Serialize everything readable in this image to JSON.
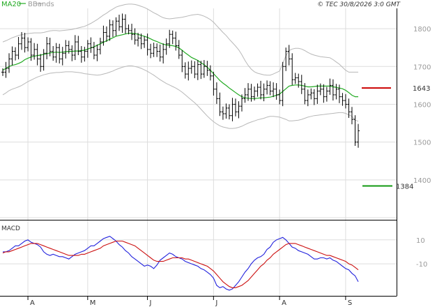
{
  "header": {
    "legend_ma": "MA20",
    "legend_bb": "BBands",
    "copyright": "© TEC 30/8/2026 3:0 GMT"
  },
  "macd_panel": {
    "title": "MACD"
  },
  "colors": {
    "ma": "#22aa22",
    "bbands": "#b8b8b8",
    "price": "#000000",
    "macd": "#2222dd",
    "signal": "#cc1111",
    "resistance": "#cc0000",
    "support": "#119911",
    "grid": "#dddddd"
  },
  "chart_data": [
    {
      "type": "ohlc",
      "x_tick_labels": [
        "A",
        "M",
        "J",
        "J",
        "A",
        "S"
      ],
      "y_ticks": [
        1400,
        1500,
        1600,
        1700,
        1800
      ],
      "ylim": [
        1300,
        1850
      ],
      "grid": true,
      "levels": [
        {
          "name": "resistance",
          "value": 1643,
          "label": "1643"
        },
        {
          "name": "support",
          "value": 1384,
          "label": "1384"
        }
      ],
      "close_series": [
        1685,
        1695,
        1720,
        1740,
        1730,
        1760,
        1775,
        1750,
        1765,
        1730,
        1745,
        1720,
        1700,
        1735,
        1760,
        1740,
        1725,
        1750,
        1720,
        1735,
        1755,
        1745,
        1730,
        1765,
        1740,
        1725,
        1740,
        1760,
        1750,
        1730,
        1745,
        1765,
        1790,
        1780,
        1810,
        1795,
        1820,
        1805,
        1825,
        1800,
        1795,
        1785,
        1770,
        1775,
        1760,
        1770,
        1745,
        1735,
        1750,
        1740,
        1725,
        1745,
        1760,
        1785,
        1775,
        1755,
        1730,
        1700,
        1680,
        1695,
        1700,
        1680,
        1705,
        1680,
        1700,
        1690,
        1675,
        1640,
        1615,
        1580,
        1575,
        1590,
        1570,
        1600,
        1580,
        1595,
        1615,
        1625,
        1640,
        1620,
        1635,
        1645,
        1625,
        1640,
        1650,
        1635,
        1640,
        1625,
        1610,
        1700,
        1740,
        1720,
        1665,
        1670,
        1660,
        1640,
        1610,
        1625,
        1630,
        1615,
        1635,
        1640,
        1620,
        1635,
        1650,
        1625,
        1640,
        1620,
        1610,
        1600,
        1580,
        1560,
        1500,
        1530
      ],
      "ma20": [
        1690,
        1695,
        1700,
        1703,
        1705,
        1708,
        1712,
        1718,
        1722,
        1725,
        1727,
        1729,
        1730,
        1732,
        1734,
        1736,
        1737,
        1738,
        1737,
        1738,
        1739,
        1740,
        1740,
        1741,
        1741,
        1742,
        1743,
        1746,
        1749,
        1752,
        1756,
        1760,
        1764,
        1768,
        1772,
        1776,
        1780,
        1782,
        1784,
        1786,
        1788,
        1788,
        1787,
        1785,
        1782,
        1780,
        1777,
        1773,
        1769,
        1766,
        1762,
        1759,
        1757,
        1756,
        1755,
        1753,
        1749,
        1743,
        1736,
        1730,
        1724,
        1720,
        1716,
        1710,
        1705,
        1698,
        1690,
        1681,
        1672,
        1663,
        1656,
        1650,
        1643,
        1637,
        1631,
        1625,
        1620,
        1617,
        1616,
        1615,
        1615,
        1616,
        1617,
        1617,
        1618,
        1619,
        1621,
        1624,
        1627,
        1634,
        1641,
        1648,
        1650,
        1651,
        1651,
        1650,
        1648,
        1646,
        1646,
        1647,
        1648,
        1648,
        1648,
        1648,
        1648,
        1646,
        1645,
        1643,
        1641,
        1637,
        1631,
        1624,
        1620,
        1620
      ],
      "bb_upper": [
        1765,
        1768,
        1772,
        1776,
        1779,
        1782,
        1784,
        1786,
        1787,
        1788,
        1789,
        1789,
        1789,
        1790,
        1792,
        1794,
        1795,
        1795,
        1794,
        1795,
        1796,
        1797,
        1798,
        1800,
        1802,
        1804,
        1806,
        1810,
        1814,
        1819,
        1824,
        1830,
        1836,
        1841,
        1847,
        1852,
        1857,
        1860,
        1862,
        1864,
        1865,
        1865,
        1864,
        1862,
        1859,
        1856,
        1852,
        1847,
        1842,
        1838,
        1833,
        1829,
        1827,
        1826,
        1827,
        1828,
        1829,
        1830,
        1832,
        1834,
        1836,
        1837,
        1838,
        1836,
        1833,
        1829,
        1824,
        1817,
        1808,
        1799,
        1790,
        1782,
        1772,
        1763,
        1754,
        1744,
        1731,
        1716,
        1703,
        1693,
        1686,
        1682,
        1680,
        1678,
        1677,
        1677,
        1680,
        1684,
        1688,
        1708,
        1728,
        1742,
        1746,
        1748,
        1748,
        1746,
        1742,
        1737,
        1733,
        1730,
        1728,
        1726,
        1725,
        1724,
        1723,
        1718,
        1712,
        1706,
        1698,
        1690,
        1685,
        1685,
        1685,
        1685
      ],
      "bb_lower": [
        1625,
        1630,
        1636,
        1640,
        1643,
        1646,
        1650,
        1655,
        1660,
        1664,
        1668,
        1672,
        1675,
        1678,
        1680,
        1682,
        1683,
        1684,
        1684,
        1685,
        1686,
        1686,
        1686,
        1685,
        1684,
        1683,
        1681,
        1680,
        1679,
        1678,
        1677,
        1678,
        1680,
        1682,
        1685,
        1688,
        1692,
        1695,
        1698,
        1700,
        1702,
        1702,
        1700,
        1698,
        1695,
        1691,
        1687,
        1682,
        1677,
        1671,
        1665,
        1660,
        1655,
        1651,
        1647,
        1643,
        1638,
        1632,
        1625,
        1618,
        1611,
        1604,
        1596,
        1587,
        1578,
        1569,
        1561,
        1554,
        1548,
        1543,
        1540,
        1538,
        1536,
        1536,
        1537,
        1539,
        1542,
        1546,
        1550,
        1553,
        1556,
        1559,
        1561,
        1563,
        1566,
        1568,
        1568,
        1567,
        1566,
        1563,
        1560,
        1556,
        1556,
        1557,
        1558,
        1560,
        1563,
        1566,
        1568,
        1570,
        1571,
        1572,
        1573,
        1574,
        1575,
        1576,
        1577,
        1578,
        1578,
        1576,
        1572,
        1568,
        1558,
        1555
      ],
      "macd_y_ticks": [
        10,
        -10
      ],
      "macd_ylim": [
        -35,
        25
      ],
      "macd": [
        0,
        0,
        1,
        3,
        5,
        5,
        7,
        9,
        10,
        8,
        7,
        6,
        4,
        0,
        -2,
        -3,
        -2,
        -3,
        -4,
        -4,
        -5,
        -6,
        -4,
        -2,
        -1,
        0,
        1,
        3,
        5,
        5,
        7,
        9,
        11,
        12,
        13,
        11,
        9,
        6,
        4,
        1,
        -1,
        -4,
        -6,
        -8,
        -10,
        -12,
        -11,
        -12,
        -14,
        -11,
        -7,
        -5,
        -3,
        -1,
        -2,
        -4,
        -5,
        -6,
        -8,
        -9,
        -10,
        -11,
        -12,
        -14,
        -15,
        -17,
        -19,
        -22,
        -28,
        -30,
        -29,
        -31,
        -32,
        -31,
        -28,
        -25,
        -21,
        -17,
        -14,
        -10,
        -7,
        -5,
        -4,
        -2,
        2,
        4,
        8,
        10,
        11,
        12,
        10,
        7,
        4,
        3,
        1,
        0,
        -1,
        -2,
        -4,
        -6,
        -6,
        -5,
        -5,
        -6,
        -5,
        -7,
        -8,
        -10,
        -12,
        -14,
        -15,
        -18,
        -20,
        -25
      ]
    }
  ],
  "signal_series": [
    -1,
    0,
    0,
    1,
    2,
    3,
    4,
    5,
    6,
    7,
    7,
    7,
    6,
    5,
    4,
    3,
    2,
    1,
    0,
    -1,
    -2,
    -3,
    -3,
    -3,
    -3,
    -2,
    -2,
    -1,
    0,
    1,
    2,
    3,
    5,
    6,
    7,
    8,
    9,
    9,
    9,
    8,
    7,
    6,
    5,
    3,
    1,
    -1,
    -3,
    -5,
    -7,
    -8,
    -8,
    -8,
    -7,
    -6,
    -5,
    -5,
    -5,
    -5,
    -6,
    -6,
    -7,
    -8,
    -9,
    -10,
    -11,
    -12,
    -14,
    -16,
    -19,
    -22,
    -25,
    -27,
    -29,
    -30,
    -30,
    -29,
    -28,
    -26,
    -24,
    -21,
    -18,
    -15,
    -12,
    -10,
    -7,
    -5,
    -2,
    0,
    2,
    4,
    6,
    7,
    7,
    7,
    6,
    5,
    4,
    3,
    2,
    1,
    0,
    -1,
    -2,
    -3,
    -3,
    -4,
    -5,
    -6,
    -7,
    -8,
    -10,
    -11,
    -13,
    -15
  ]
}
